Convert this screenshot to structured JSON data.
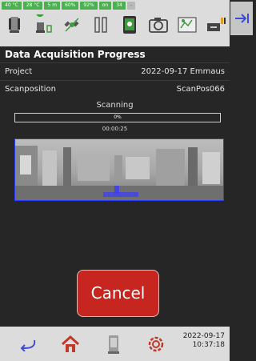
{
  "status_badges": [
    "40 °C",
    "28 °C",
    "5 m",
    "60%",
    "92%",
    "on",
    "34",
    "-"
  ],
  "toolbar_icons": [
    "scanner-icon",
    "scanner-gps-icon",
    "satellite-icon",
    "pause-icon",
    "tablet-icon",
    "camera-icon",
    "map-icon",
    "usb-drive-icon",
    "exit-icon"
  ],
  "title": "Data Acquisition Progress",
  "rows": [
    {
      "label": "Project",
      "value": "2022-09-17 Emmaus"
    },
    {
      "label": "Scanposition",
      "value": "ScanPos066"
    }
  ],
  "scan": {
    "status": "Scanning",
    "progress": 0,
    "progress_label": "0%",
    "elapsed": "00:00:25"
  },
  "cancel_label": "Cancel",
  "bottom": {
    "date": "2022-09-17",
    "time": "10:37:18"
  },
  "colors": {
    "accent": "#4caf50",
    "cancel": "#c6261f",
    "pano_border": "#2a3cff",
    "home": "#c0392b"
  }
}
